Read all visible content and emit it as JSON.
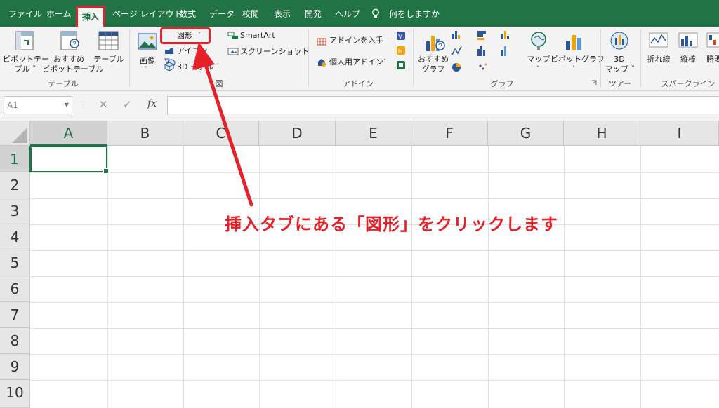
{
  "tabs": [
    {
      "label": "ファイル",
      "active": false
    },
    {
      "label": "ホーム",
      "active": false
    },
    {
      "label": "挿入",
      "active": true
    },
    {
      "label": "ページ レイアウト",
      "active": false
    },
    {
      "label": "数式",
      "active": false
    },
    {
      "label": "データ",
      "active": false
    },
    {
      "label": "校閲",
      "active": false
    },
    {
      "label": "表示",
      "active": false
    },
    {
      "label": "開発",
      "active": false
    },
    {
      "label": "ヘルプ",
      "active": false
    }
  ],
  "tell_me": "何をしますか",
  "ribbon": {
    "table_group": {
      "pivot_line1": "ピボットテー",
      "pivot_line2": "ブル ˅",
      "rec_pivot_line1": "おすすめ",
      "rec_pivot_line2": "ピボットテーブル",
      "table": "テーブル",
      "group_label": "テーブル"
    },
    "illust_group": {
      "picture": "画像",
      "shapes": "図形",
      "icons": "アイコン",
      "models3d": "3D モデル",
      "smartart": "SmartArt",
      "screenshot": "スクリーンショット",
      "group_label": "図"
    },
    "addin_group": {
      "get_addins": "アドインを入手",
      "my_addins": "個人用アドイン",
      "group_label": "アドイン"
    },
    "chart_group": {
      "rec_charts_line1": "おすすめ",
      "rec_charts_line2": "グラフ",
      "maps": "マップ",
      "pivot_chart": "ピボットグラフ",
      "group_label": "グラフ"
    },
    "tour_group": {
      "map3d_line1": "3D",
      "map3d_line2": "マップ ˅",
      "group_label": "ツアー"
    },
    "spark_group": {
      "line": "折れ線",
      "column": "縦棒",
      "winloss": "勝敗",
      "group_label": "スパークライン"
    }
  },
  "formula_bar": {
    "name_box": "A1",
    "cancel": "✕",
    "enter": "✓",
    "fx": "fx",
    "value": ""
  },
  "columns": [
    "A",
    "B",
    "C",
    "D",
    "E",
    "F",
    "G",
    "H",
    "I"
  ],
  "rows": [
    "1",
    "2",
    "3",
    "4",
    "5",
    "6",
    "7",
    "8",
    "9",
    "10"
  ],
  "selected_cell": "A1",
  "annotation": "挿入タブにある「図形」をクリックします",
  "colors": {
    "excel_green": "#217346",
    "highlight_red": "#e6212a"
  }
}
